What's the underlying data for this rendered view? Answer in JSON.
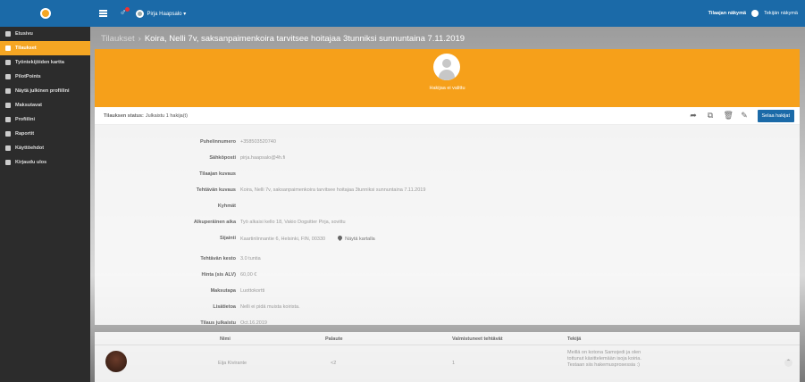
{
  "topbar": {
    "user_name": "Pirja Haapsalo ▾",
    "role_active": "Tilaajan näkymä",
    "role_other": "Tekijän näkymä"
  },
  "sidebar": {
    "items": [
      {
        "label": "Etusivu",
        "icon": "home-icon"
      },
      {
        "label": "Tilaukset",
        "icon": "orders-icon",
        "active": true
      },
      {
        "label": "Työntekijöiden kartta",
        "icon": "map-icon"
      },
      {
        "label": "PilotPoints",
        "icon": "points-icon"
      },
      {
        "label": "Näytä julkinen profiilini",
        "icon": "star-icon"
      },
      {
        "label": "Maksutavat",
        "icon": "card-icon"
      },
      {
        "label": "Profiilini",
        "icon": "user-icon"
      },
      {
        "label": "Raportit",
        "icon": "report-icon"
      },
      {
        "label": "Käyttöehdot",
        "icon": "terms-icon"
      },
      {
        "label": "Kirjaudu ulos",
        "icon": "logout-icon"
      }
    ]
  },
  "page": {
    "breadcrumb": "Tilaukset",
    "separator": "›",
    "title": "Koira, Nelli 7v, saksanpaimenkoira tarvitsee hoitajaa 3tunniksi sunnuntaina 7.11.2019"
  },
  "hero": {
    "label": "Hakijaa ei valittu"
  },
  "panel": {
    "status_label": "Tilauksen status:",
    "status_value": "Julkaistu 1 hakija(t)",
    "browse_button": "Selaa hakijat"
  },
  "details": [
    {
      "label": "Puhelinnumero",
      "value": "+358503520740"
    },
    {
      "label": "Sähköposti",
      "value": "pirja.haapsalo@4h.fi"
    },
    {
      "label": "Tilaajan kuvaus",
      "value": ""
    },
    {
      "label": "Tehtävän kuvaus",
      "value": "Koira, Nelli 7v, saksanpaimenkoira tarvitsee hoitajaa 3tunniksi sunnuntaina 7.11.2019"
    },
    {
      "label": "Kyhmät",
      "value": ""
    },
    {
      "label": "Alkuperäinen aika",
      "value": "Työ alkaisi kello 18, Vakio Dogsitter Pirja, sovittu"
    },
    {
      "label": "Sijainti",
      "value": "Kaartinlinnantie 6, Helsinki, FIN, 00330",
      "maplink": "Näytä kartalla"
    },
    {
      "label": "Tehtävän kesto",
      "value": "3.0 tuntia"
    },
    {
      "label": "Hinta (sis ALV)",
      "value": "60,00 €"
    },
    {
      "label": "Maksutapa",
      "value": "Luottokortti"
    },
    {
      "label": "Lisätietoa",
      "value": "Nelli ei pidä muista koirista."
    },
    {
      "label": "Tilaus julkaistu",
      "value": "Oct.16.2019"
    }
  ],
  "applicants": {
    "headers": {
      "name": "Nimi",
      "feedback": "Palaute",
      "done": "Valmistuneet tehtävät",
      "worker": "Tekijä"
    },
    "rows": [
      {
        "name": "Eija Kivirante",
        "feedback": "<2",
        "done": "1",
        "description": "Meillä on kotona Samojedi ja olen tottunut käsittelemään isoja koiria. Testaan siis hakemusprosessia :)"
      }
    ]
  }
}
